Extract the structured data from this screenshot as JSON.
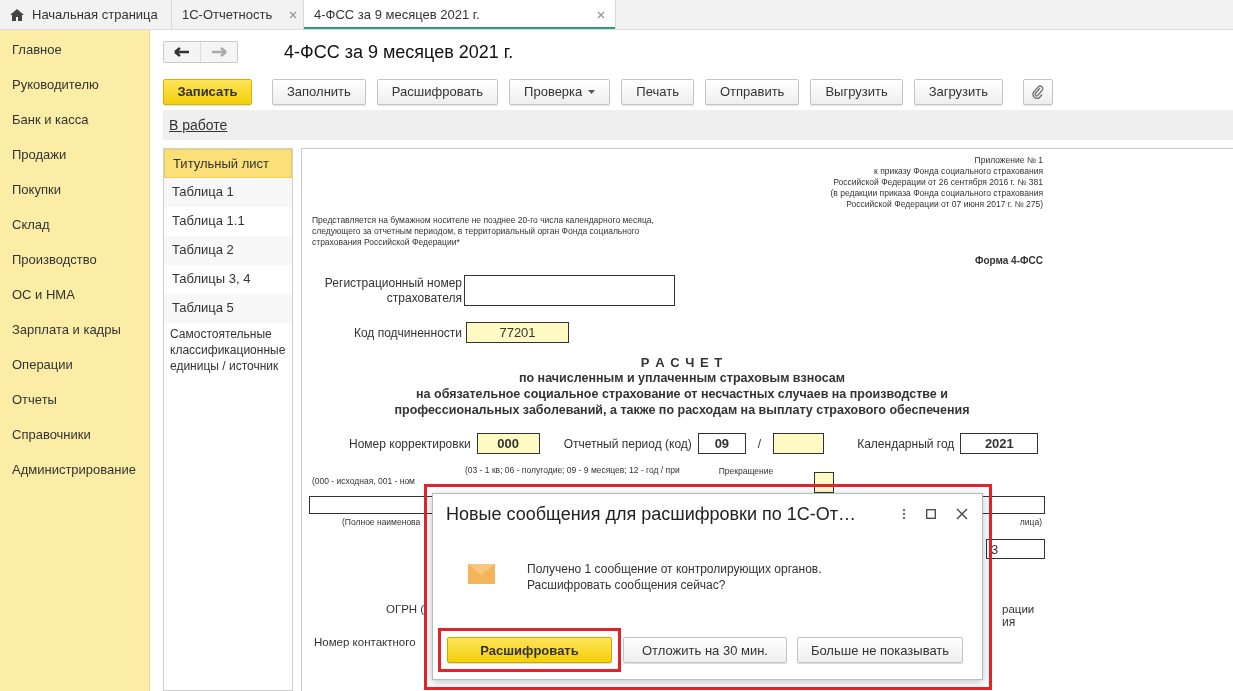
{
  "tabs": [
    {
      "label": "Начальная страница",
      "kind": "home",
      "selected": false
    },
    {
      "label": "1С-Отчетность",
      "kind": "closable",
      "selected": false
    },
    {
      "label": "4-ФСС за 9 месяцев 2021 г.",
      "kind": "closable",
      "selected": true
    }
  ],
  "sidebar": {
    "items": [
      "Главное",
      "Руководителю",
      "Банк и касса",
      "Продажи",
      "Покупки",
      "Склад",
      "Производство",
      "ОС и НМА",
      "Зарплата и кадры",
      "Операции",
      "Отчеты",
      "Справочники",
      "Администрирование"
    ]
  },
  "document": {
    "title": "4-ФСС за 9 месяцев 2021 г.",
    "toolbar": [
      {
        "label": "Записать",
        "kind": "primary"
      },
      {
        "label": "Заполнить",
        "kind": "plain"
      },
      {
        "label": "Расшифровать",
        "kind": "plain"
      },
      {
        "label": "Проверка",
        "kind": "dropdown"
      },
      {
        "label": "Печать",
        "kind": "plain"
      },
      {
        "label": "Отправить",
        "kind": "plain"
      },
      {
        "label": "Выгрузить",
        "kind": "plain"
      },
      {
        "label": "Загрузить",
        "kind": "plain"
      },
      {
        "kind": "attach"
      }
    ],
    "status_link": "В работе",
    "sections": [
      {
        "label": "Титульный лист",
        "selected": true
      },
      {
        "label": "Таблица 1",
        "selected": false
      },
      {
        "label": "Таблица 1.1",
        "selected": false
      },
      {
        "label": "Таблица 2",
        "selected": false
      },
      {
        "label": "Таблицы 3, 4",
        "selected": false
      },
      {
        "label": "Таблица 5",
        "selected": false
      },
      {
        "label": "Самостоятельные классификационные единицы / источник",
        "selected": false
      }
    ],
    "form": {
      "appendix": [
        "Приложение № 1",
        "к приказу Фонда социального страхования",
        "Российской Федерации от 26 сентября 2016 г. № 381",
        "(в редакции приказа Фонда социального страхования",
        "Российской Федерации от 07 июня 2017 г. № 275)"
      ],
      "notice": [
        "Представляется на бумажном носителе не позднее 20-го числа календарного месяца,",
        "следующего за отчетным периодом, в территориальный орган Фонда социального",
        "страхования Российской Федерации*"
      ],
      "form_name": "Форма 4-ФСС",
      "reg_number_label": "Регистрационный номер страхователя",
      "subordination": {
        "label": "Код подчиненности",
        "value": "77201"
      },
      "heading": "Р А С Ч Е Т",
      "subheading": [
        "по начисленным и уплаченным страховым взносам",
        "на обязательное социальное страхование от несчастных случаев на производстве и",
        "профессиональных заболеваний, а также по расходам на выплату страхового обеспечения"
      ],
      "correction": {
        "label": "Номер корректировки",
        "value": "000"
      },
      "period": {
        "label": "Отчетный период (код)",
        "value": "09",
        "separator": "/"
      },
      "year": {
        "label": "Календарный год",
        "value": "2021"
      },
      "correction_hint": "(000 - исходная, 001 - ном",
      "period_hint": "(03 - 1 кв; 06 - полугодие; 09 - 9 месяцев; 12 - год / при",
      "termination_label": "Прекращение",
      "name_hint_left": "(Полное наименова",
      "name_hint_right": "лица)",
      "field_value": "3",
      "ogrn_label": "ОГРН (",
      "right_fragment_1": "рации",
      "right_fragment_2": "ия",
      "phone_label": "Номер контактного"
    }
  },
  "dialog": {
    "title": "Новые сообщения для расшифровки по 1С-От…",
    "highlighted": true,
    "message": [
      "Получено 1 сообщение от контролирующих органов.",
      "Расшифровать сообщения сейчас?"
    ],
    "buttons": [
      {
        "label": "Расшифровать",
        "kind": "primary",
        "highlighted": true
      },
      {
        "label": "Отложить на 30 мин.",
        "kind": "plain",
        "highlighted": false
      },
      {
        "label": "Больше не показывать",
        "kind": "plain",
        "highlighted": false
      }
    ]
  }
}
